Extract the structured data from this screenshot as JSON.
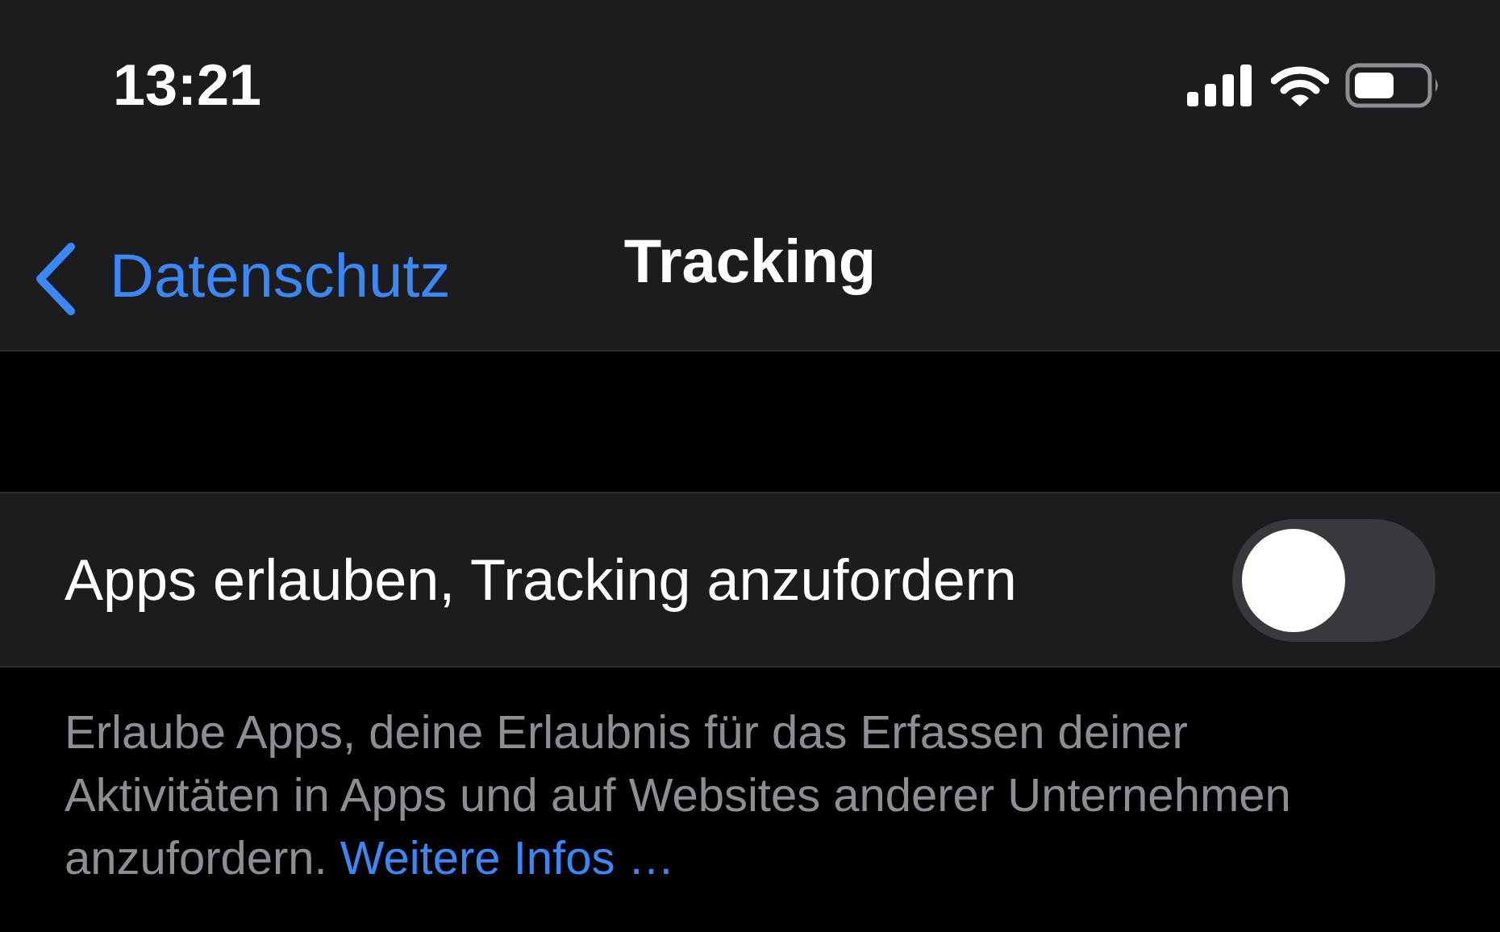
{
  "status_bar": {
    "time": "13:21"
  },
  "nav": {
    "back_label": "Datenschutz",
    "title": "Tracking"
  },
  "setting": {
    "label": "Apps erlauben, Tracking anzufordern",
    "on": false
  },
  "footer": {
    "text": "Erlaube Apps, deine Erlaubnis für das Erfassen deiner Aktivitäten in Apps und auf Websites anderer Unternehmen anzufordern.",
    "link": "Weitere Infos …"
  }
}
